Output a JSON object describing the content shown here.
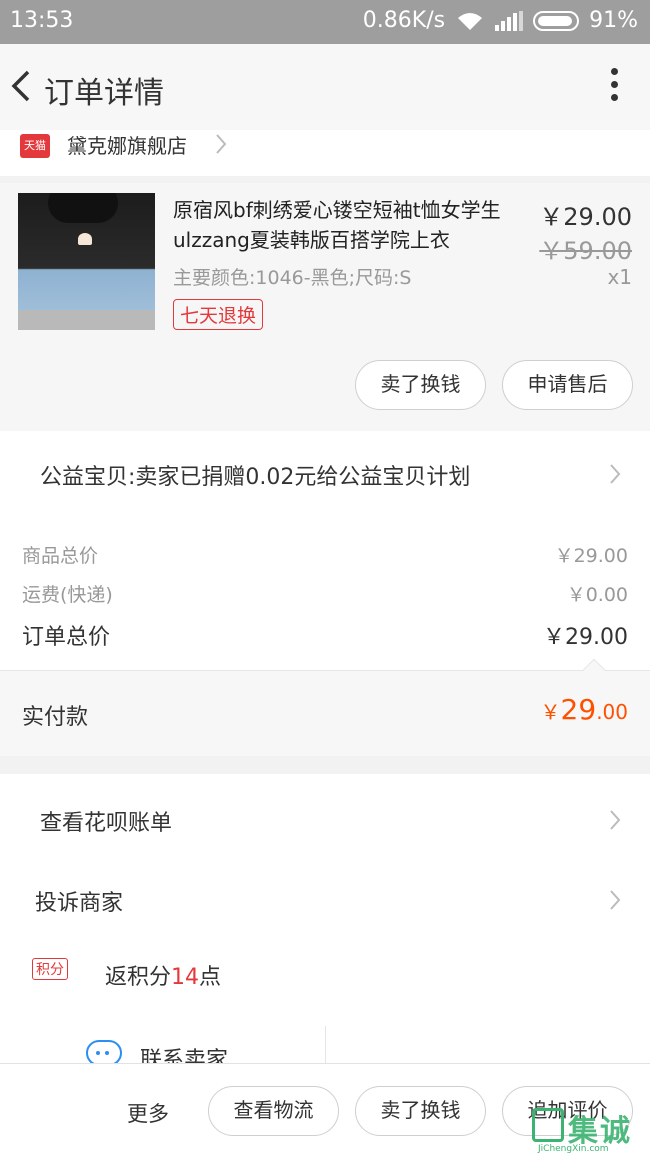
{
  "status": {
    "time": "13:53",
    "speed": "0.86K/s",
    "battery": "91%"
  },
  "nav": {
    "title": "订单详情"
  },
  "shop": {
    "badge": "天猫",
    "name": "黛克娜旗舰店"
  },
  "product": {
    "title": "原宿风bf刺绣爱心镂空短袖t恤女学生ulzzang夏装韩版百搭学院上衣",
    "spec": "主要颜色:1046-黑色;尺码:S",
    "tag": "七天退换",
    "price": "￥29.00",
    "original_price": "￥59.00",
    "qty": "x1",
    "btn_sell": "卖了换钱",
    "btn_after": "申请售后"
  },
  "charity": {
    "text": "公益宝贝:卖家已捐赠0.02元给公益宝贝计划"
  },
  "costs": {
    "goods_label": "商品总价",
    "goods_value": "￥29.00",
    "ship_label": "运费(快递)",
    "ship_value": "￥0.00",
    "total_label": "订单总价",
    "total_value": "￥29.00"
  },
  "paid": {
    "label": "实付款",
    "currency": "￥",
    "int": "29",
    "dec": ".00"
  },
  "menu": {
    "huabei": "查看花呗账单",
    "complain": "投诉商家",
    "points_badge": "积分",
    "points_pre": "返积分",
    "points_num": "14",
    "points_post": "点",
    "contact": "联系卖家"
  },
  "bottom": {
    "more": "更多",
    "logistics": "查看物流",
    "sell": "卖了换钱",
    "review": "追加评价"
  },
  "watermark": {
    "text": "集诚信",
    "sub": "JiChengXin.com"
  }
}
